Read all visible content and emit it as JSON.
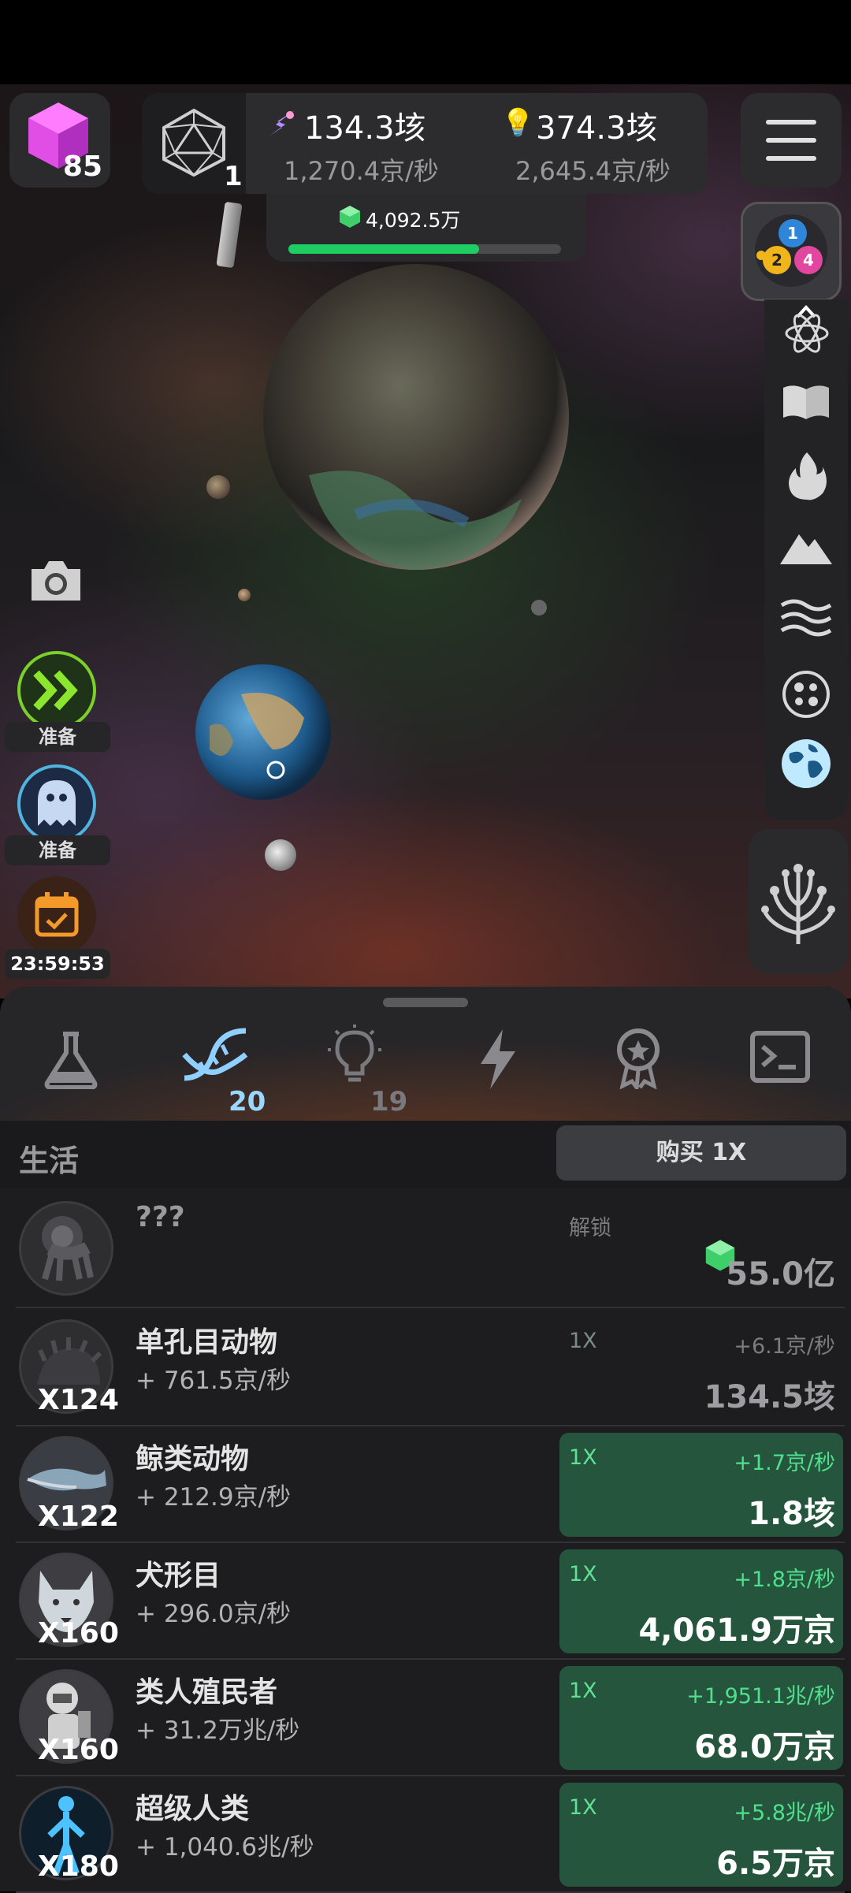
{
  "hud": {
    "cube_count": "85",
    "icosa_level": "1",
    "energy_total": "134.3垓",
    "energy_rate": "1,270.4京/秒",
    "idea_total": "374.3垓",
    "idea_rate": "2,645.4京/秒",
    "gem_progress_label": "4,092.5万",
    "gem_progress_fraction": 0.7,
    "orb_numbers": [
      "1",
      "2",
      "4"
    ]
  },
  "left_buttons": {
    "boost_label": "准备",
    "ghost_label": "准备",
    "timer": "23:59:53"
  },
  "side_icons": [
    "atom-icon",
    "book-icon",
    "fire-icon",
    "mountain-icon",
    "waves-icon",
    "cells-icon",
    "globe-icon"
  ],
  "tabs": {
    "dna_count": "20",
    "idea_count": "19"
  },
  "section": {
    "title": "生活",
    "buy_label": "购买 1X"
  },
  "rows": [
    {
      "name": "???",
      "unlock": "解锁",
      "cost": "55.0亿"
    },
    {
      "name": "单孔目动物",
      "count": "X124",
      "rate": "+ 761.5京/秒",
      "mult": "1X",
      "gain": "+6.1京/秒",
      "cost": "134.5垓",
      "affordable": false
    },
    {
      "name": "鲸类动物",
      "count": "X122",
      "rate": "+ 212.9京/秒",
      "mult": "1X",
      "gain": "+1.7京/秒",
      "cost": "1.8垓",
      "affordable": true
    },
    {
      "name": "犬形目",
      "count": "X160",
      "rate": "+ 296.0京/秒",
      "mult": "1X",
      "gain": "+1.8京/秒",
      "cost": "4,061.9万京",
      "affordable": true
    },
    {
      "name": "类人殖民者",
      "count": "X160",
      "rate": "+ 31.2万兆/秒",
      "mult": "1X",
      "gain": "+1,951.1兆/秒",
      "cost": "68.0万京",
      "affordable": true
    },
    {
      "name": "超级人类",
      "count": "X180",
      "rate": "+ 1,040.6兆/秒",
      "mult": "1X",
      "gain": "+5.8兆/秒",
      "cost": "6.5万京",
      "affordable": true
    }
  ],
  "colors": {
    "accent_green": "#1fce62",
    "buy_green": "#26553d",
    "panel": "#2c2c2f"
  }
}
